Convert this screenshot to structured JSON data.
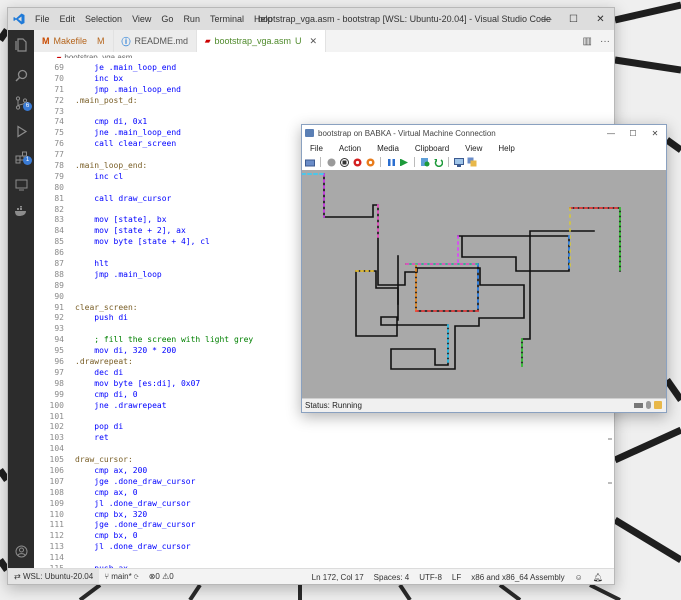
{
  "vscode": {
    "menu": [
      "File",
      "Edit",
      "Selection",
      "View",
      "Go",
      "Run",
      "Terminal",
      "Help"
    ],
    "title": "bootstrap_vga.asm - bootstrap [WSL: Ubuntu-20.04] - Visual Studio Code",
    "tabs": [
      {
        "icon": "M",
        "label": "Makefile",
        "status": "M",
        "active": false,
        "status_color": "#b5651d"
      },
      {
        "icon": "⓵",
        "label": "README.md",
        "status": "",
        "active": false
      },
      {
        "icon": "asm",
        "label": "bootstrap_vga.asm",
        "status": "U",
        "active": true
      }
    ],
    "breadcrumb": "bootstrap_vga.asm",
    "activity_badges": {
      "source_control": "6",
      "extensions": "1"
    },
    "code": [
      {
        "n": "69",
        "t": "    je .main_loop_end"
      },
      {
        "n": "70",
        "t": "    inc bx"
      },
      {
        "n": "71",
        "t": "    jmp .main_loop_end"
      },
      {
        "n": "72",
        "t": ".main_post_d:"
      },
      {
        "n": "73",
        "t": ""
      },
      {
        "n": "74",
        "t": "    cmp di, 0x1"
      },
      {
        "n": "75",
        "t": "    jne .main_loop_end"
      },
      {
        "n": "76",
        "t": "    call clear_screen"
      },
      {
        "n": "77",
        "t": ""
      },
      {
        "n": "78",
        "t": ".main_loop_end:"
      },
      {
        "n": "79",
        "t": "    inc cl"
      },
      {
        "n": "80",
        "t": ""
      },
      {
        "n": "81",
        "t": "    call draw_cursor"
      },
      {
        "n": "82",
        "t": ""
      },
      {
        "n": "83",
        "t": "    mov [state], bx"
      },
      {
        "n": "84",
        "t": "    mov [state + 2], ax"
      },
      {
        "n": "85",
        "t": "    mov byte [state + 4], cl"
      },
      {
        "n": "86",
        "t": ""
      },
      {
        "n": "87",
        "t": "    hlt"
      },
      {
        "n": "88",
        "t": "    jmp .main_loop"
      },
      {
        "n": "89",
        "t": ""
      },
      {
        "n": "90",
        "t": ""
      },
      {
        "n": "91",
        "t": "clear_screen:"
      },
      {
        "n": "92",
        "t": "    push di"
      },
      {
        "n": "93",
        "t": ""
      },
      {
        "n": "94",
        "t": "    ; fill the screen with light grey"
      },
      {
        "n": "95",
        "t": "    mov di, 320 * 200"
      },
      {
        "n": "96",
        "t": ".drawrepeat:"
      },
      {
        "n": "97",
        "t": "    dec di"
      },
      {
        "n": "98",
        "t": "    mov byte [es:di], 0x07"
      },
      {
        "n": "99",
        "t": "    cmp di, 0"
      },
      {
        "n": "100",
        "t": "    jne .drawrepeat"
      },
      {
        "n": "101",
        "t": ""
      },
      {
        "n": "102",
        "t": "    pop di"
      },
      {
        "n": "103",
        "t": "    ret"
      },
      {
        "n": "104",
        "t": ""
      },
      {
        "n": "105",
        "t": "draw_cursor:"
      },
      {
        "n": "106",
        "t": "    cmp ax, 200"
      },
      {
        "n": "107",
        "t": "    jge .done_draw_cursor"
      },
      {
        "n": "108",
        "t": "    cmp ax, 0"
      },
      {
        "n": "109",
        "t": "    jl .done_draw_cursor"
      },
      {
        "n": "110",
        "t": "    cmp bx, 320"
      },
      {
        "n": "111",
        "t": "    jge .done_draw_cursor"
      },
      {
        "n": "112",
        "t": "    cmp bx, 0"
      },
      {
        "n": "113",
        "t": "    jl .done_draw_cursor"
      },
      {
        "n": "114",
        "t": ""
      },
      {
        "n": "115",
        "t": "    push ax"
      }
    ],
    "status": {
      "remote": "WSL: Ubuntu-20.04",
      "branch": "main*",
      "problems": "⊗0 ⚠0",
      "position": "Ln 172, Col 17",
      "spaces": "Spaces: 4",
      "encoding": "UTF-8",
      "eol": "LF",
      "language": "x86 and x86_64 Assembly"
    }
  },
  "vm": {
    "title": "bootstrap on BABKA - Virtual Machine Connection",
    "menu": [
      "File",
      "Action",
      "Media",
      "Clipboard",
      "View",
      "Help"
    ],
    "status": "Status: Running",
    "screen_bg": "#a9a9a9"
  }
}
